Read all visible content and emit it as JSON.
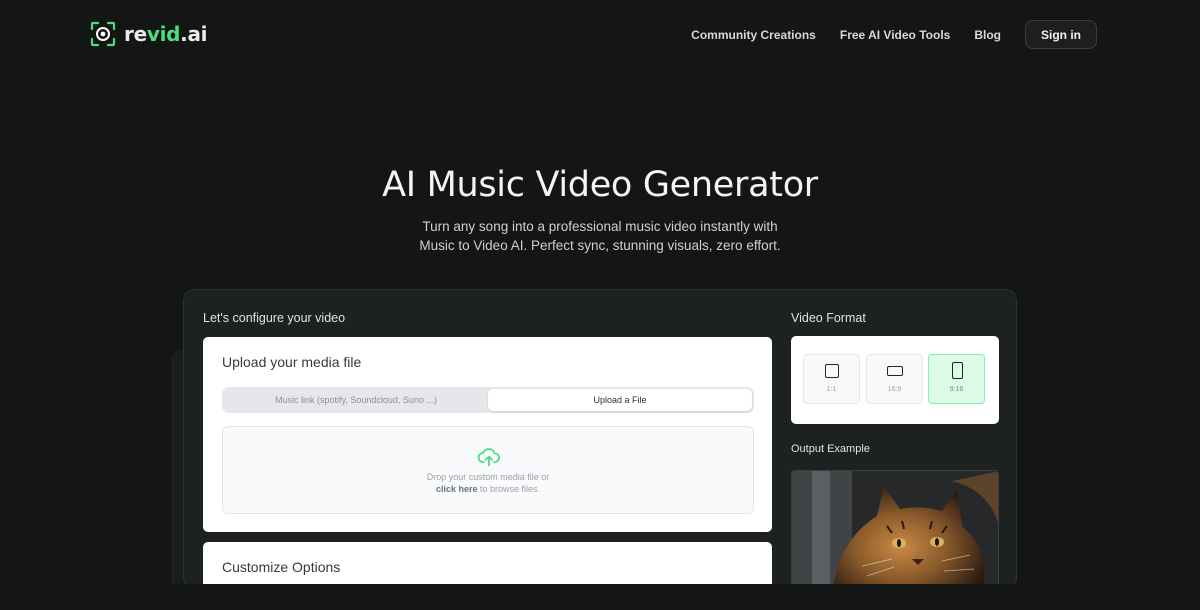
{
  "brand": {
    "name_prefix": "re",
    "name_accent": "vid",
    "name_suffix": ".ai"
  },
  "nav": {
    "links": [
      "Community Creations",
      "Free AI Video Tools",
      "Blog"
    ],
    "signin_label": "Sign in"
  },
  "hero": {
    "title": "AI Music Video Generator",
    "subtitle_line1": "Turn any song into a professional music video instantly with",
    "subtitle_line2": "Music to Video AI. Perfect sync, stunning visuals, zero effort."
  },
  "config": {
    "heading": "Let's configure your video",
    "upload": {
      "title": "Upload your media file",
      "tabs": [
        "Music link (spotify, Soundcloud, Suno ...)",
        "Upload a File"
      ],
      "active_tab": "Upload a File",
      "drop_line1": "Drop your custom media file or",
      "drop_link": "click here",
      "drop_line2_rest": " to browse files."
    },
    "customize_title": "Customize Options"
  },
  "format": {
    "heading": "Video Format",
    "options": [
      "1:1",
      "16:9",
      "9:16"
    ],
    "selected": "9:16"
  },
  "output": {
    "heading": "Output Example"
  },
  "colors": {
    "background": "#141515",
    "accent": "#4ade80",
    "panel": "#1d2120",
    "selected_format": "#dcfce7"
  }
}
